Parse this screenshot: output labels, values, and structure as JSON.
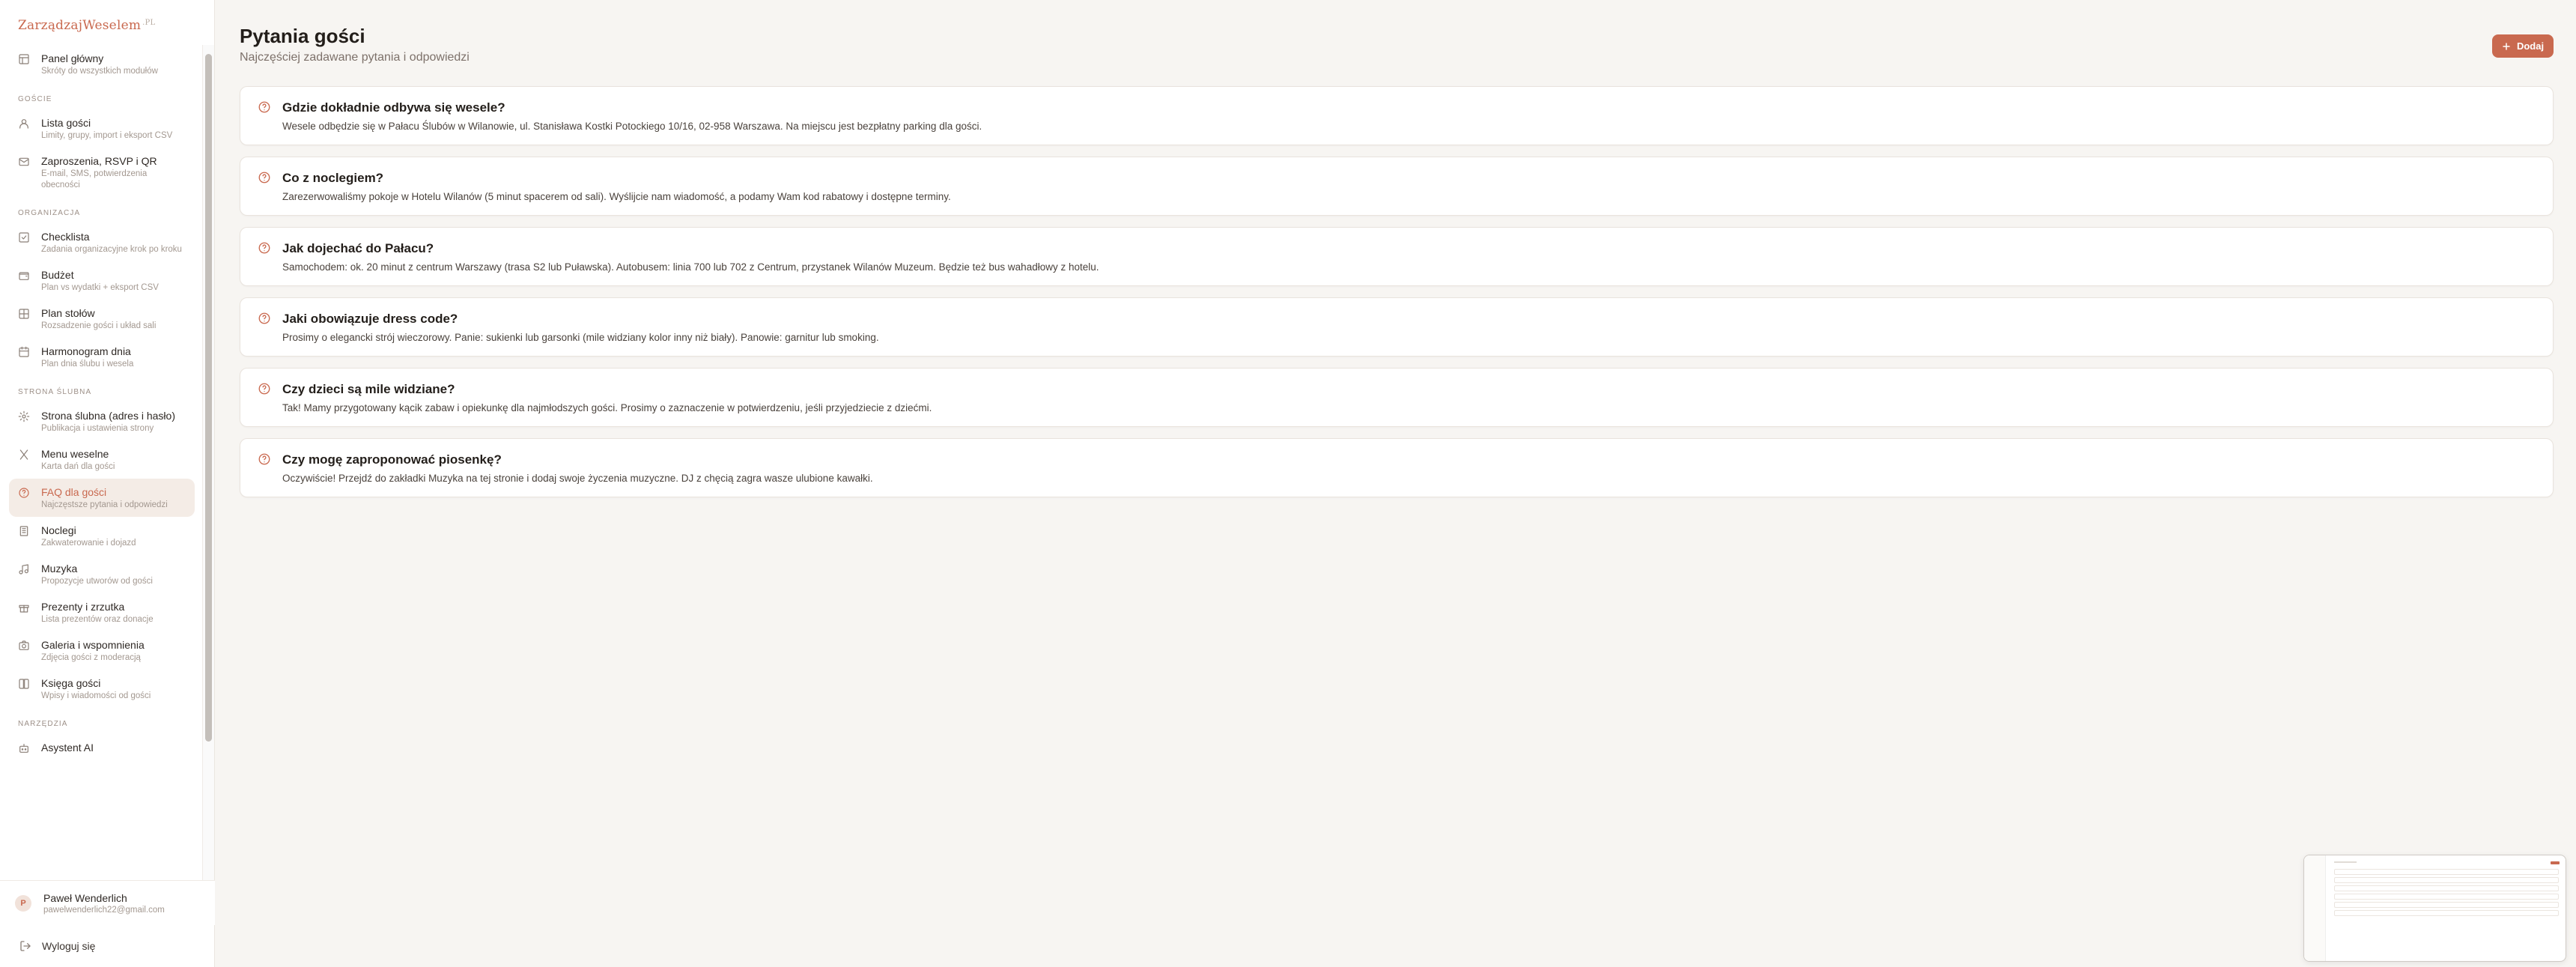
{
  "app": {
    "logo": "ZarządzajWeselem",
    "logo_suffix": ".PL"
  },
  "sidebar": {
    "items_top": [
      {
        "title": "Panel główny",
        "sub": "Skróty do wszystkich modułów",
        "icon": "dashboard-icon"
      }
    ],
    "sections": [
      {
        "label": "Goście",
        "items": [
          {
            "title": "Lista gości",
            "sub": "Limity, grupy, import i eksport CSV",
            "icon": "user-icon"
          },
          {
            "title": "Zaproszenia, RSVP i QR",
            "sub": "E-mail, SMS, potwierdzenia obecności",
            "icon": "mail-icon"
          }
        ]
      },
      {
        "label": "Organizacja",
        "items": [
          {
            "title": "Checklista",
            "sub": "Zadania organizacyjne krok po kroku",
            "icon": "checklist-icon"
          },
          {
            "title": "Budżet",
            "sub": "Plan vs wydatki + eksport CSV",
            "icon": "wallet-icon"
          },
          {
            "title": "Plan stołów",
            "sub": "Rozsadzenie gości i układ sali",
            "icon": "table-layout-icon"
          },
          {
            "title": "Harmonogram dnia",
            "sub": "Plan dnia ślubu i wesela",
            "icon": "calendar-icon"
          }
        ]
      },
      {
        "label": "Strona ślubna",
        "items": [
          {
            "title": "Strona ślubna (adres i hasło)",
            "sub": "Publikacja i ustawienia strony",
            "icon": "settings-icon"
          },
          {
            "title": "Menu weselne",
            "sub": "Karta dań dla gości",
            "icon": "utensils-icon"
          },
          {
            "title": "FAQ dla gości",
            "sub": "Najczęstsze pytania i odpowiedzi",
            "icon": "help-circle-icon",
            "active": true
          },
          {
            "title": "Noclegi",
            "sub": "Zakwaterowanie i dojazd",
            "icon": "building-icon"
          },
          {
            "title": "Muzyka",
            "sub": "Propozycje utworów od gości",
            "icon": "music-icon"
          },
          {
            "title": "Prezenty i zrzutka",
            "sub": "Lista prezentów oraz donacje",
            "icon": "gift-icon"
          },
          {
            "title": "Galeria i wspomnienia",
            "sub": "Zdjęcia gości z moderacją",
            "icon": "camera-icon"
          },
          {
            "title": "Księga gości",
            "sub": "Wpisy i wiadomości od gości",
            "icon": "book-icon"
          }
        ]
      },
      {
        "label": "Narzędzia",
        "items": [
          {
            "title": "Asystent AI",
            "sub": "",
            "icon": "robot-icon"
          }
        ]
      }
    ],
    "user": {
      "initial": "P",
      "name": "Paweł Wenderlich",
      "email": "pawelwenderlich22@gmail.com"
    },
    "logout_label": "Wyloguj się"
  },
  "header": {
    "title": "Pytania gości",
    "subtitle": "Najczęściej zadawane pytania i odpowiedzi",
    "add_label": "Dodaj"
  },
  "faq": [
    {
      "q": "Gdzie dokładnie odbywa się wesele?",
      "a": "Wesele odbędzie się w Pałacu Ślubów w Wilanowie, ul. Stanisława Kostki Potockiego 10/16, 02-958 Warszawa. Na miejscu jest bezpłatny parking dla gości."
    },
    {
      "q": "Co z noclegiem?",
      "a": "Zarezerwowaliśmy pokoje w Hotelu Wilanów (5 minut spacerem od sali). Wyślijcie nam wiadomość, a podamy Wam kod rabatowy i dostępne terminy."
    },
    {
      "q": "Jak dojechać do Pałacu?",
      "a": "Samochodem: ok. 20 minut z centrum Warszawy (trasa S2 lub Puławska). Autobusem: linia 700 lub 702 z Centrum, przystanek Wilanów Muzeum. Będzie też bus wahadłowy z hotelu."
    },
    {
      "q": "Jaki obowiązuje dress code?",
      "a": "Prosimy o elegancki strój wieczorowy. Panie: sukienki lub garsonki (mile widziany kolor inny niż biały). Panowie: garnitur lub smoking."
    },
    {
      "q": "Czy dzieci są mile widziane?",
      "a": "Tak! Mamy przygotowany kącik zabaw i opiekunkę dla najmłodszych gości. Prosimy o zaznaczenie w potwierdzeniu, jeśli przyjedziecie z dziećmi."
    },
    {
      "q": "Czy mogę zaproponować piosenkę?",
      "a": "Oczywiście! Przejdź do zakładki Muzyka na tej stronie i dodaj swoje życzenia muzyczne. DJ z chęcią zagra wasze ulubione kawałki."
    }
  ],
  "colors": {
    "accent": "#c9694f",
    "background": "#f7f5f2",
    "card": "#ffffff"
  }
}
